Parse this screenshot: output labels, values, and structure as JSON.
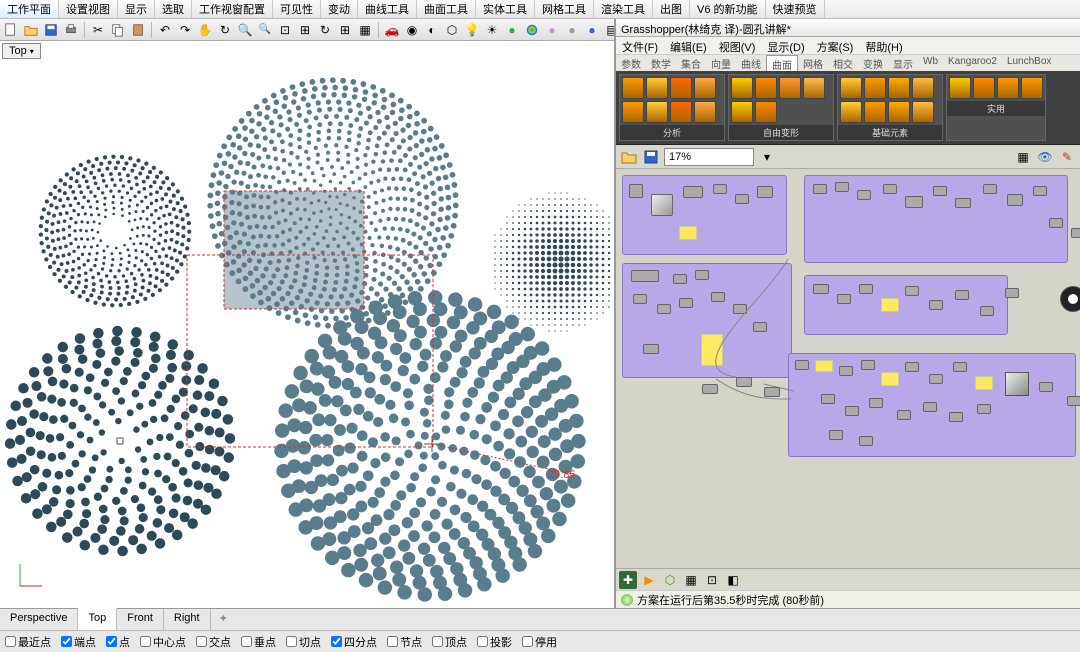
{
  "rhino_menu": [
    "工作平面",
    "设置视图",
    "显示",
    "选取",
    "工作视窗配置",
    "可见性",
    "变动",
    "曲线工具",
    "曲面工具",
    "实体工具",
    "网格工具",
    "渲染工具",
    "出图",
    "V6 的新功能",
    "快速预览"
  ],
  "viewport_label": "Top",
  "vp_tabs": [
    "Perspective",
    "Top",
    "Front",
    "Right"
  ],
  "status_items": [
    "最近点",
    "端点",
    "点",
    "中心点",
    "交点",
    "垂点",
    "切点",
    "四分点",
    "节点",
    "顶点",
    "投影",
    "停用"
  ],
  "status_checked": [
    false,
    true,
    true,
    false,
    false,
    false,
    false,
    true,
    false,
    false,
    false,
    false
  ],
  "dimension_text": "29.85",
  "gh": {
    "title": "Grasshopper(林绮克 译)-圆孔讲解*",
    "menu": [
      "文件(F)",
      "编辑(E)",
      "视图(V)",
      "显示(D)",
      "方案(S)",
      "帮助(H)"
    ],
    "tabs": [
      "参数",
      "数学",
      "集合",
      "向量",
      "曲线",
      "曲面",
      "网格",
      "相交",
      "变换",
      "显示",
      "Wb",
      "Kangaroo2",
      "LunchBox"
    ],
    "active_tab": 5,
    "ribbon_groups": [
      "分析",
      "自由变形",
      "基础元素",
      "实用"
    ],
    "zoom": "17%",
    "status": "方案在运行后第35.5秒时完成 (80秒前)"
  }
}
